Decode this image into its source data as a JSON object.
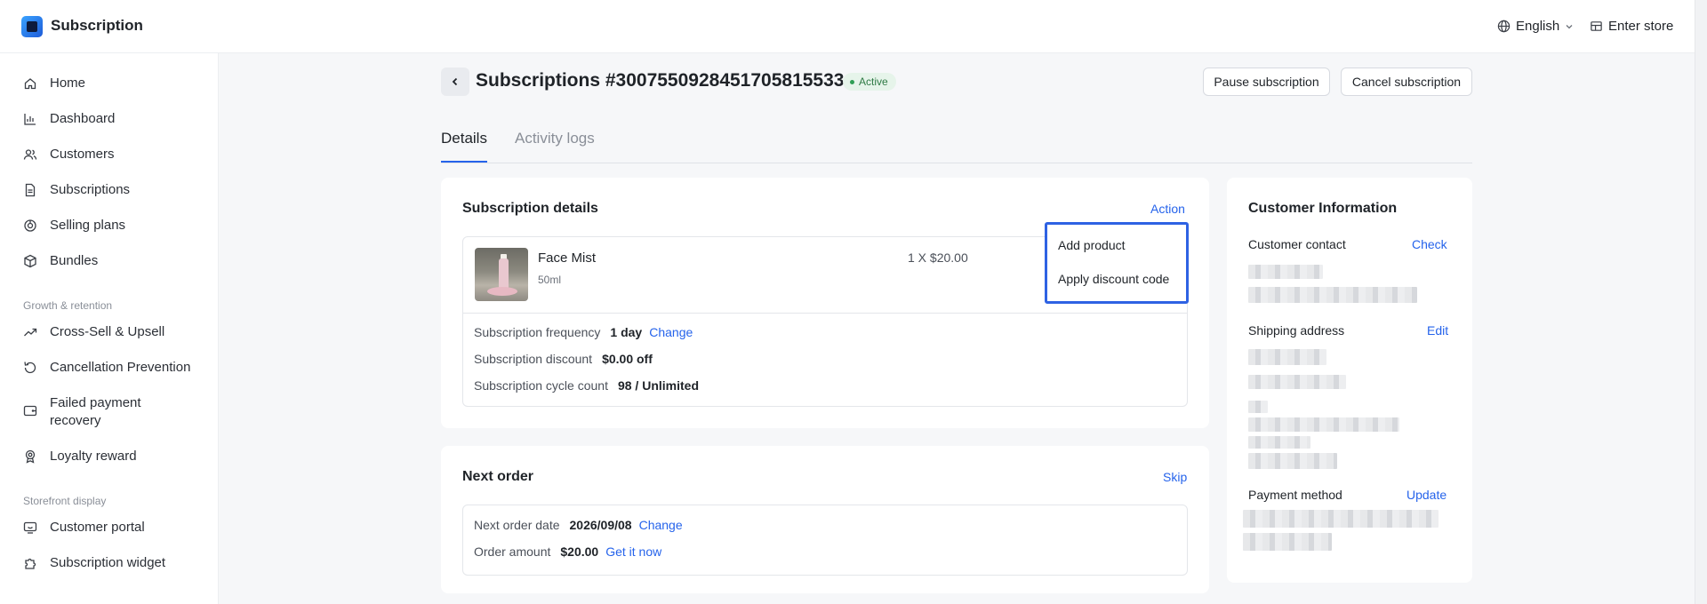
{
  "app": {
    "title": "Subscription"
  },
  "topbar": {
    "language": "English",
    "enter_store": "Enter store"
  },
  "sidebar": {
    "items": [
      {
        "label": "Home",
        "icon": "home-icon"
      },
      {
        "label": "Dashboard",
        "icon": "chart-icon"
      },
      {
        "label": "Customers",
        "icon": "users-icon"
      },
      {
        "label": "Subscriptions",
        "icon": "document-icon"
      },
      {
        "label": "Selling plans",
        "icon": "plans-icon"
      },
      {
        "label": "Bundles",
        "icon": "box-icon"
      }
    ],
    "section_growth": "Growth & retention",
    "growth_items": [
      {
        "label": "Cross-Sell & Upsell",
        "icon": "trend-up-icon"
      },
      {
        "label": "Cancellation Prevention",
        "icon": "refresh-icon"
      },
      {
        "label": "Failed payment recovery",
        "icon": "wallet-icon"
      },
      {
        "label": "Loyalty reward",
        "icon": "award-icon"
      }
    ],
    "section_storefront": "Storefront display",
    "storefront_items": [
      {
        "label": "Customer portal",
        "icon": "portal-icon"
      },
      {
        "label": "Subscription widget",
        "icon": "puzzle-icon"
      }
    ]
  },
  "header": {
    "title": "Subscriptions #3007550928451705815533",
    "status": "Active",
    "pause_label": "Pause subscription",
    "cancel_label": "Cancel subscription"
  },
  "tabs": [
    {
      "label": "Details"
    },
    {
      "label": "Activity logs"
    }
  ],
  "subscription_details": {
    "title": "Subscription details",
    "action_label": "Action",
    "product": {
      "name": "Face Mist",
      "variant": "50ml",
      "qty_price": "1 X $20.00"
    },
    "frequency_label": "Subscription frequency",
    "frequency_value": "1 day",
    "frequency_change": "Change",
    "discount_label": "Subscription discount",
    "discount_value": "$0.00 off",
    "cycle_label": "Subscription cycle count",
    "cycle_value": "98 / Unlimited"
  },
  "action_menu": {
    "add_product": "Add product",
    "apply_discount": "Apply discount code"
  },
  "next_order": {
    "title": "Next order",
    "skip_label": "Skip",
    "date_label": "Next order date",
    "date_value": "2026/09/08",
    "date_change": "Change",
    "amount_label": "Order amount",
    "amount_value": "$20.00",
    "get_now": "Get it now"
  },
  "customer_info": {
    "title": "Customer Information",
    "contact_label": "Customer contact",
    "contact_link": "Check",
    "shipping_label": "Shipping address",
    "shipping_link": "Edit",
    "payment_label": "Payment method",
    "payment_link": "Update"
  }
}
